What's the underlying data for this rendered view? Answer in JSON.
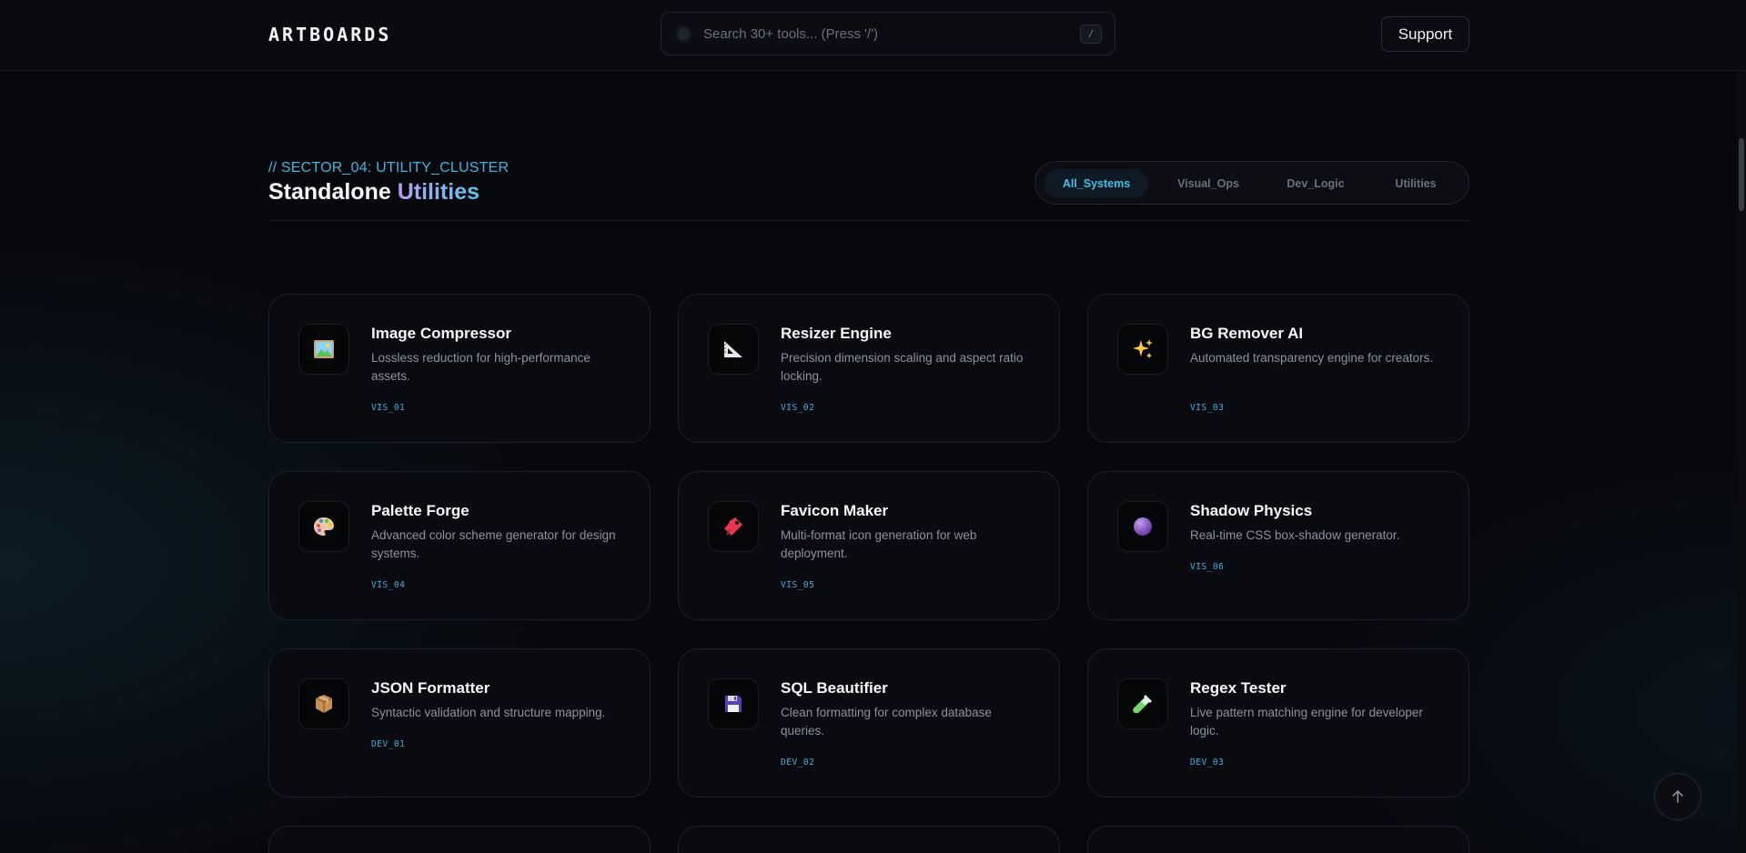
{
  "header": {
    "logo": "ARTBOARDS",
    "search": {
      "placeholder": "Search 30+ tools... (Press '/')",
      "shortcut": "/"
    },
    "support_label": "Support"
  },
  "section": {
    "kicker": "// SECTOR_04: UTILITY_CLUSTER",
    "title_main": "Standalone",
    "title_accent": "Utilities",
    "filters": [
      {
        "label": "All_Systems",
        "active": true
      },
      {
        "label": "Visual_Ops",
        "active": false
      },
      {
        "label": "Dev_Logic",
        "active": false
      },
      {
        "label": "Utilities",
        "active": false
      }
    ]
  },
  "tools": [
    {
      "title": "Image Compressor",
      "desc": "Lossless reduction for high-performance assets.",
      "code": "VIS_01",
      "icon": "image-icon"
    },
    {
      "title": "Resizer Engine",
      "desc": "Precision dimension scaling and aspect ratio locking.",
      "code": "VIS_02",
      "icon": "triangle-ruler-icon"
    },
    {
      "title": "BG Remover AI",
      "desc": "Automated transparency engine for creators.",
      "code": "VIS_03",
      "icon": "sparkles-icon"
    },
    {
      "title": "Palette Forge",
      "desc": "Advanced color scheme generator for design systems.",
      "code": "VIS_04",
      "icon": "palette-icon"
    },
    {
      "title": "Favicon Maker",
      "desc": "Multi-format icon generation for web deployment.",
      "code": "VIS_05",
      "icon": "bookmark-tag-icon"
    },
    {
      "title": "Shadow Physics",
      "desc": "Real-time CSS box-shadow generator.",
      "code": "VIS_06",
      "icon": "purple-sphere-icon"
    },
    {
      "title": "JSON Formatter",
      "desc": "Syntactic validation and structure mapping.",
      "code": "DEV_01",
      "icon": "package-icon"
    },
    {
      "title": "SQL Beautifier",
      "desc": "Clean formatting for complex database queries.",
      "code": "DEV_02",
      "icon": "floppy-disk-icon"
    },
    {
      "title": "Regex Tester",
      "desc": "Live pattern matching engine for developer logic.",
      "code": "DEV_03",
      "icon": "test-tube-icon"
    }
  ],
  "colors": {
    "background": "#07080c",
    "accent_cyan": "#3db2dc",
    "accent_purple": "#b89cf4",
    "card_bg": "#0a0b10"
  }
}
